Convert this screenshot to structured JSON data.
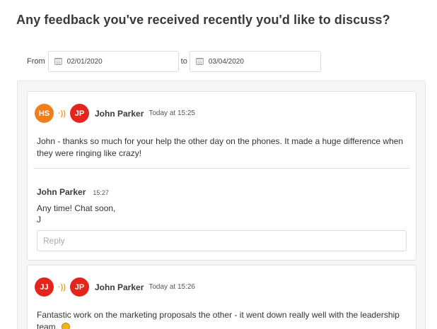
{
  "page": {
    "title": "Any feedback you've received recently you'd like to discuss?"
  },
  "filter": {
    "from_label": "From",
    "from_value": "02/01/2020",
    "to_label": "to",
    "to_value": "03/04/2020"
  },
  "colors": {
    "avatar_hs": "#f07f1b",
    "avatar_jp": "#e5241c",
    "avatar_jj": "#e5241c",
    "wave": "#f0a31a"
  },
  "feedback": [
    {
      "sender_initials": "HS",
      "recipient_initials": "JP",
      "recipient_name": "John Parker",
      "time": "Today at 15:25",
      "message": "John - thanks so much for your help the other day on the phones. It made a huge difference when they were ringing like crazy!",
      "reply": {
        "name": "John Parker",
        "time": "15:27",
        "lines": [
          "Any time! Chat soon,",
          "J"
        ]
      },
      "reply_placeholder": "Reply"
    },
    {
      "sender_initials": "JJ",
      "recipient_initials": "JP",
      "recipient_name": "John Parker",
      "time": "Today at 15:26",
      "message": "Fantastic work on the marketing proposals the other - it went down really well with the leadership team.",
      "emoji": "clapping-hands-emoji"
    }
  ]
}
